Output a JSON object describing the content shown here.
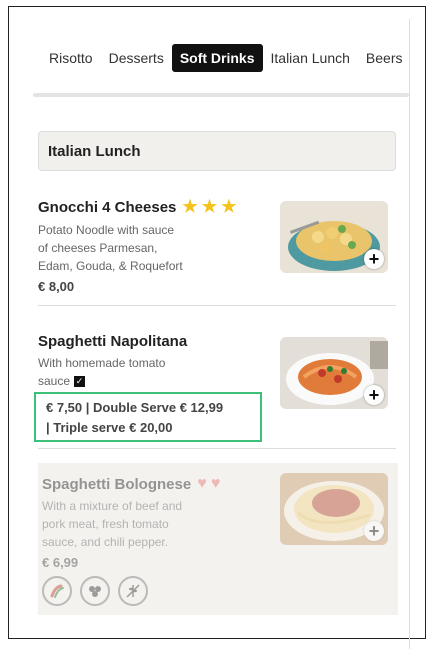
{
  "tabs": [
    {
      "label": "Risotto",
      "active": false
    },
    {
      "label": "Desserts",
      "active": false
    },
    {
      "label": "Soft Drinks",
      "active": true
    },
    {
      "label": "Italian Lunch",
      "active": false
    },
    {
      "label": "Beers",
      "active": false
    }
  ],
  "section": {
    "title": "Italian Lunch"
  },
  "items": [
    {
      "title": "Gnocchi 4 Cheeses",
      "desc_lines": [
        "Potato Noodle with sauce",
        "of cheeses Parmesan,",
        "Edam, Gouda, & Roquefort"
      ],
      "price": "€ 8,00",
      "rating_icons": "star-icon",
      "rating_count": 3
    },
    {
      "title": "Spaghetti Napolitana",
      "desc_lines": [
        "With homemade tomato",
        "sauce"
      ],
      "serves_line1": "€ 7,50   |   Double Serve   € 12,99",
      "serves_line2": "|   Triple serve   € 20,00"
    },
    {
      "title": "Spaghetti Bolognese",
      "desc_lines": [
        "With a mixture of beef and",
        "pork meat, fresh tomato",
        "sauce, and chili pepper."
      ],
      "price": "€ 6,99",
      "rating_icons": "heart-icon",
      "rating_count": 2,
      "badge_icons": [
        "chili-pepper-icon",
        "meatball-icon",
        "no-gluten-icon"
      ]
    }
  ],
  "colors": {
    "highlight_border": "#3cc07a",
    "star": "#f3c31c",
    "heart": "#e57373"
  }
}
